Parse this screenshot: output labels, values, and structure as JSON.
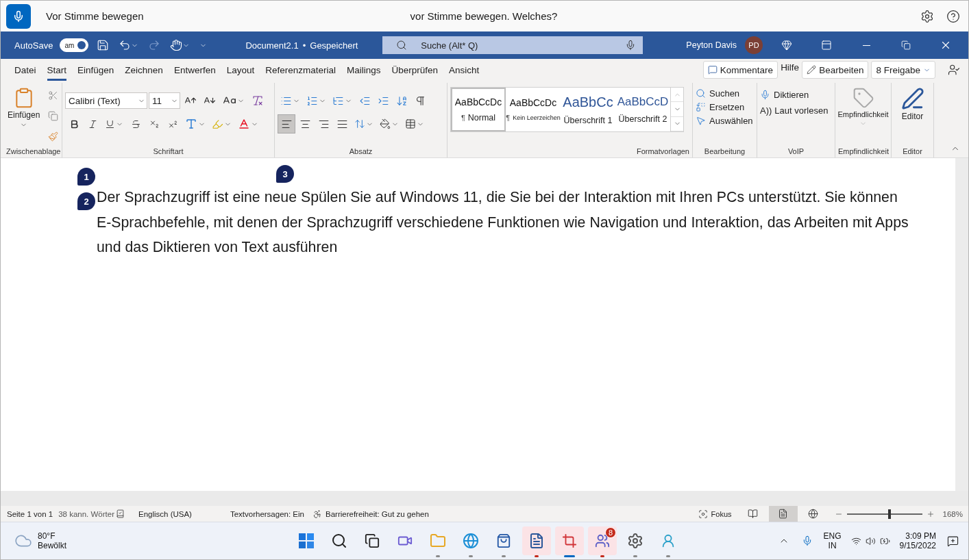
{
  "voice_bar": {
    "title": "Vor Stimme bewegen",
    "prompt": "vor Stimme bewegen. Welches?"
  },
  "title_bar": {
    "autosave_label": "AutoSave",
    "autosave_toggle": {
      "label": "am",
      "on": true
    },
    "document": "Document2.1",
    "separator": "•",
    "save_status": "Gespeichert",
    "search": {
      "placeholder": "Suche (Alt* Q)"
    },
    "user": "Peyton Davis",
    "avatar": "PD"
  },
  "tabs": [
    {
      "label": "Datei",
      "selected": false
    },
    {
      "label": "Start",
      "selected": true
    },
    {
      "label": "Einfügen",
      "selected": false
    },
    {
      "label": "Zeichnen",
      "selected": false
    },
    {
      "label": "Entwerfen",
      "selected": false
    },
    {
      "label": "Layout",
      "selected": false
    },
    {
      "label": "Referenzmaterial",
      "selected": false
    },
    {
      "label": "Mailings",
      "selected": false
    },
    {
      "label": "Überprüfen",
      "selected": false
    },
    {
      "label": "Ansicht",
      "selected": false
    }
  ],
  "tab_actions": [
    {
      "kind": "comments",
      "label": "Kommentare"
    },
    {
      "kind": "tab",
      "label": "Hilfe",
      "selected": false
    },
    {
      "kind": "edit",
      "label": "Bearbeiten"
    },
    {
      "kind": "share",
      "label": "8 Freigabe"
    }
  ],
  "ribbon": {
    "clipboard": {
      "paste": "Einfügen",
      "label": "Zwischenablage"
    },
    "font": {
      "family": "Calibri (Text)",
      "size": "11",
      "label": "Schriftart"
    },
    "paragraph": {
      "alignment": [
        {
          "selected": true
        },
        {
          "selected": false
        },
        {
          "selected": false
        },
        {
          "selected": false
        }
      ],
      "label": "Absatz"
    },
    "styles": {
      "items": [
        {
          "kind": "normal",
          "preview": "AaBbCcDc",
          "pilcrow": "¶",
          "label": "Normal",
          "selected": true
        },
        {
          "kind": "small",
          "preview": "AaBbCcDc",
          "pilcrow": "¶",
          "label": "Kein Leerzeichen",
          "selected": false
        },
        {
          "kind": "heading1",
          "preview": "AaBbCc",
          "label": "Überschrift 1",
          "selected": false
        },
        {
          "kind": "heading2",
          "preview": "AaBbCcD",
          "label": "Überschrift 2",
          "selected": false
        }
      ],
      "label": "Formatvorlagen"
    },
    "editing": {
      "items": [
        "Suchen",
        "Ersetzen",
        "Auswählen"
      ],
      "label": "Bearbeitung"
    },
    "voice": {
      "dictate": "Diktieren",
      "read_glyph": "A))",
      "read": "Laut vorlesen",
      "label": "VoIP"
    },
    "sensitivity": {
      "button": "Empfindlichkeit",
      "label": "Empfindlichkeit"
    },
    "editor": {
      "button": "Editor",
      "label": "Editor"
    }
  },
  "document": {
    "markers": [
      "1",
      "2",
      "3"
    ],
    "paragraph": "Der Sprachzugriff ist eine neue Spülen Sie auf Windows 11, die Sie bei der Interaktion mit Ihren PCs unterstützt. Sie können E-Sprachbefehle, mit denen der Sprachzugriff verschiedene Funktionen wie Navigation und Interaktion, das Arbeiten mit Apps und das Diktieren von Text ausführen"
  },
  "status_bar": {
    "page": "Seite 1 von 1",
    "words": "38 kann. Wörter",
    "language": "Englisch (USA)",
    "predictions": "Textvorhersagen: Ein",
    "accessibility": "Barrierefreiheit: Gut zu gehen",
    "focus": "Fokus",
    "views": [
      {
        "selected": false
      },
      {
        "selected": true
      },
      {
        "selected": false
      }
    ],
    "zoom": {
      "level": 0.57
    },
    "zoom_reading": "168%"
  },
  "taskbar": {
    "weather": {
      "temp": "80°F",
      "condition": "Bewölkt"
    },
    "apps": [
      {
        "highlighted": false,
        "running": false,
        "focused": false,
        "attention": false
      },
      {
        "highlighted": false,
        "running": false,
        "focused": false,
        "attention": false
      },
      {
        "highlighted": false,
        "running": false,
        "focused": false,
        "attention": false
      },
      {
        "highlighted": false,
        "running": false,
        "focused": false,
        "attention": false
      },
      {
        "highlighted": false,
        "running": true,
        "focused": false,
        "attention": false
      },
      {
        "highlighted": false,
        "running": true,
        "focused": false,
        "attention": false
      },
      {
        "highlighted": false,
        "running": true,
        "focused": false,
        "attention": false
      },
      {
        "highlighted": true,
        "running": true,
        "focused": false,
        "attention": true
      },
      {
        "highlighted": true,
        "running": true,
        "focused": true,
        "attention": false
      },
      {
        "highlighted": true,
        "running": true,
        "focused": false,
        "attention": true,
        "badge": "8"
      },
      {
        "highlighted": false,
        "running": true,
        "focused": false,
        "attention": false
      },
      {
        "highlighted": false,
        "running": true,
        "focused": false,
        "attention": false
      }
    ],
    "tray": {
      "language": "ENG",
      "region": "IN",
      "time": "3:09 PM",
      "date": "9/15/2022"
    }
  }
}
